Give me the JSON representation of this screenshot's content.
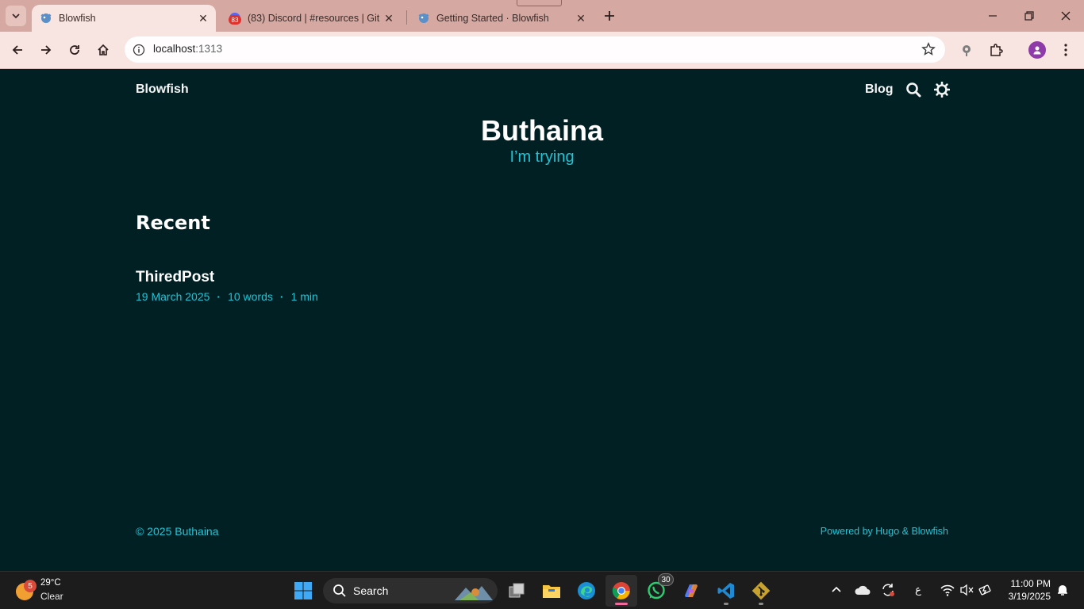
{
  "browser": {
    "tabs": [
      {
        "title": "Blowfish",
        "active": true
      },
      {
        "title": "(83) Discord | #resources | Git E",
        "badge": "83",
        "active": false
      },
      {
        "title": "Getting Started · Blowfish",
        "active": false
      }
    ],
    "address": {
      "host": "localhost",
      "port": ":1313"
    }
  },
  "site": {
    "title": "Blowfish",
    "menu": {
      "blog": "Blog"
    }
  },
  "hero": {
    "name": "Buthaina",
    "tagline": "I’m trying"
  },
  "recent": {
    "heading": "Recent",
    "posts": [
      {
        "title": "ThiredPost",
        "date": "19 March 2025",
        "words": "10 words",
        "read_time": "1 min"
      }
    ]
  },
  "footer": {
    "copyright": "© 2025 Buthaina",
    "powered": "Powered by Hugo & Blowfish"
  },
  "taskbar": {
    "weather": {
      "badge": "5",
      "temp": "29°C",
      "condition": "Clear"
    },
    "search_label": "Search",
    "whatsapp_badge": "30",
    "lang": "ع",
    "time": "11:00 PM",
    "date": "3/19/2025"
  },
  "colors": {
    "page_bg": "#012024",
    "accent": "#22c3d4",
    "tabstrip": "#d5a8a1",
    "toolbar": "#f8e4e0"
  }
}
